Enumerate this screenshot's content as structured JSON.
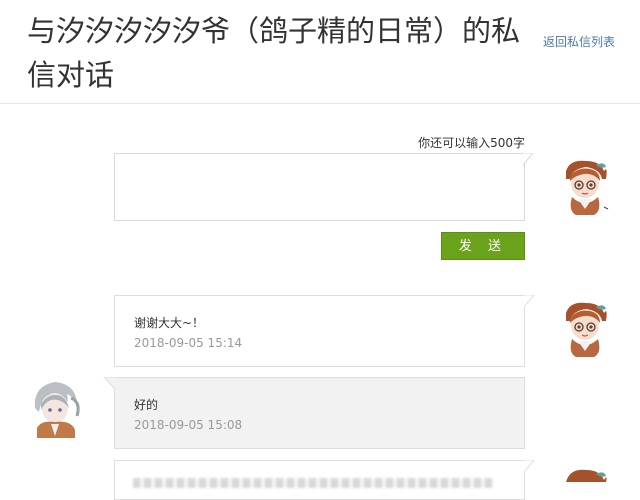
{
  "header": {
    "title": "与汐汐汐汐汐爷（鸽子精的日常）的私信对话",
    "back_link": "返回私信列表"
  },
  "compose": {
    "char_counter": "你还可以输入500字",
    "input_value": "",
    "send_label": "发 送"
  },
  "messages": [
    {
      "side": "right",
      "text": "谢谢大大~！",
      "time": "2018-09-05 15:14"
    },
    {
      "side": "left",
      "text": "好的",
      "time": "2018-09-05 15:08"
    }
  ],
  "colors": {
    "send_button": "#6aa31b",
    "link": "#4a7aa8",
    "received_bubble": "#f2f2f2"
  }
}
